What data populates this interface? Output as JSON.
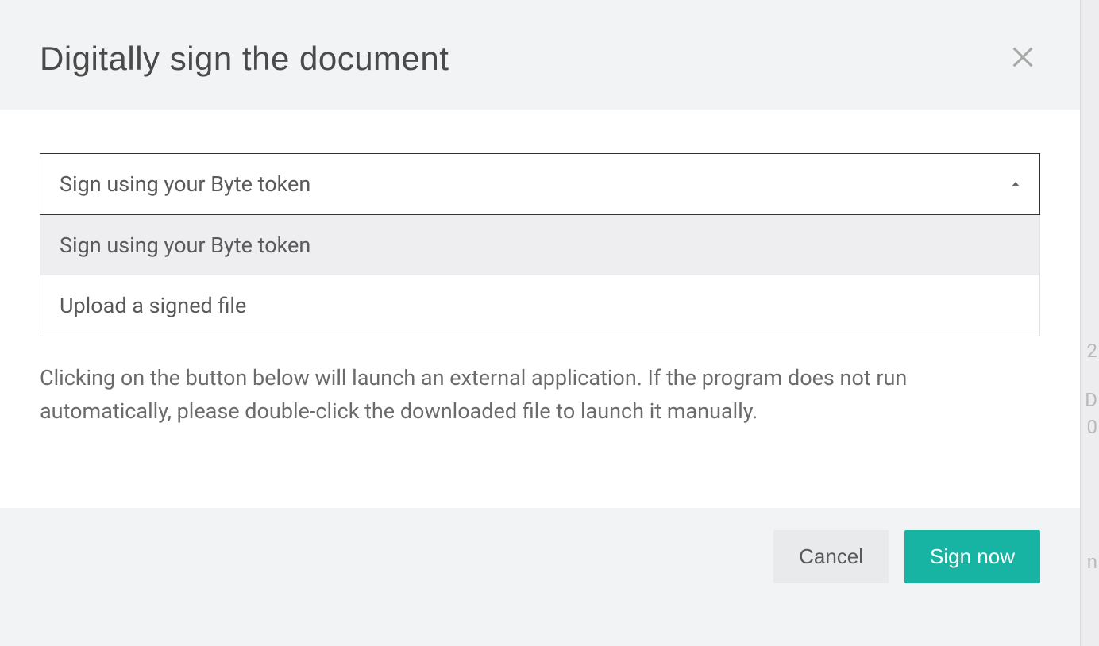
{
  "modal": {
    "title": "Digitally sign the document",
    "dropdown": {
      "selected": "Sign using your Byte token",
      "options": [
        "Sign using your Byte token",
        "Upload a signed file"
      ]
    },
    "description": "Clicking on the button below will launch an external application. If the program does not run automatically, please double-click the downloaded file to launch it manually.",
    "footer": {
      "cancel_label": "Cancel",
      "submit_label": "Sign now"
    }
  },
  "background_fragments": {
    "frag1": "2",
    "frag2": "D",
    "frag3": "0",
    "frag4": "n"
  }
}
